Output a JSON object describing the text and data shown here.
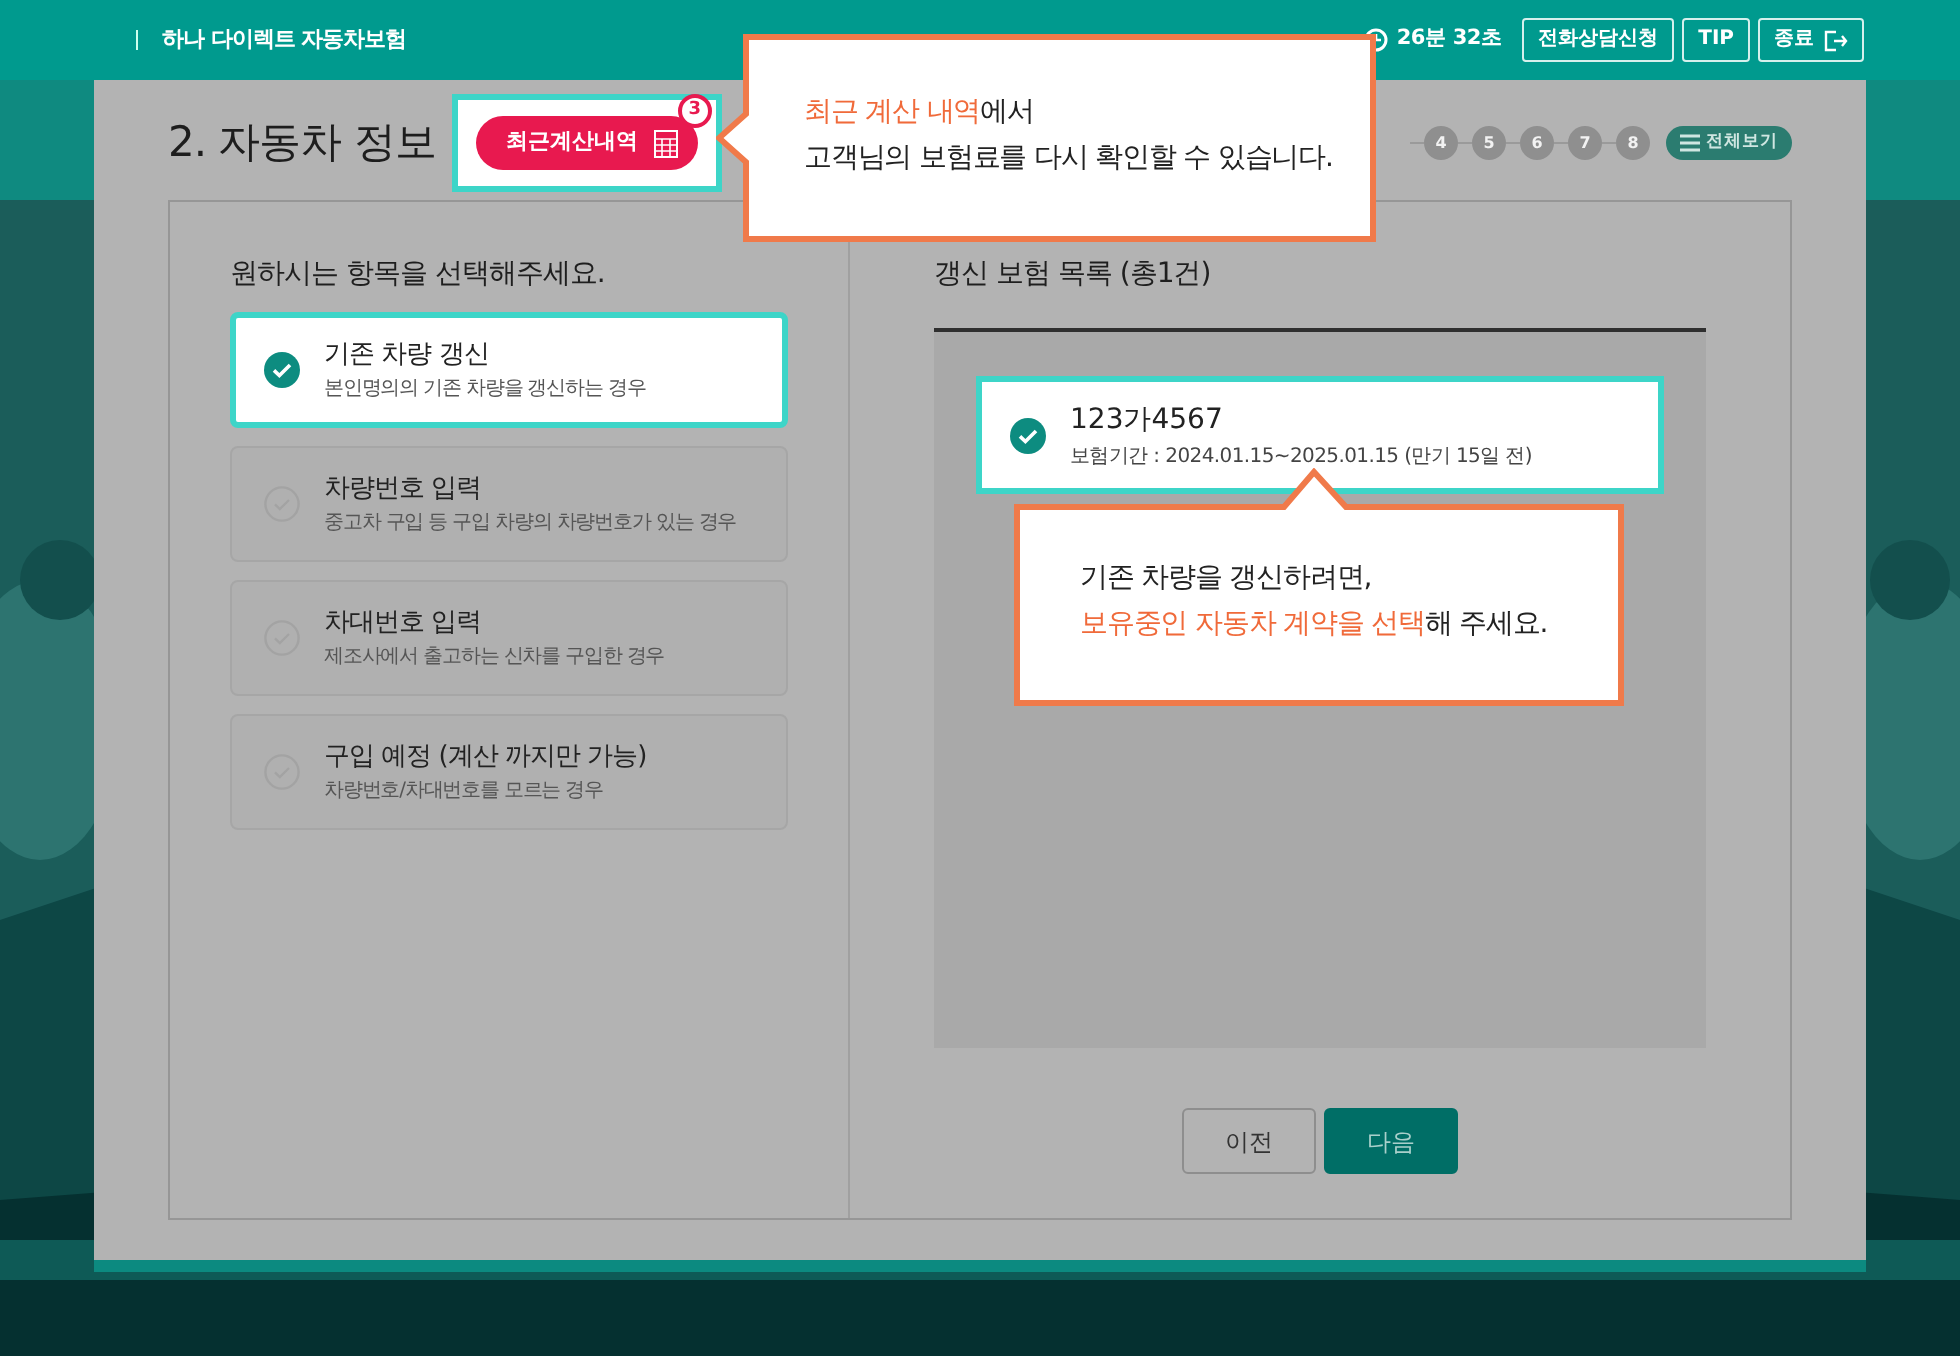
{
  "header": {
    "title": "하나 다이렉트 자동차보험",
    "timer": "26분 32초",
    "buttons": [
      {
        "label": "전화상담신청",
        "kind": "text"
      },
      {
        "label": "TIP",
        "kind": "text"
      },
      {
        "label": "종료",
        "kind": "exit"
      }
    ]
  },
  "page": {
    "title": "2. 자동차 정보",
    "recent_button": {
      "label": "최근계산내역",
      "badge": "3"
    },
    "steps": [
      {
        "label": "4"
      },
      {
        "label": "5"
      },
      {
        "label": "6"
      },
      {
        "label": "7"
      },
      {
        "label": "8"
      }
    ],
    "overview_button": "전체보기"
  },
  "options": {
    "heading": "원하시는 항목을 선택해주세요.",
    "items": [
      {
        "title": "기존 차량 갱신",
        "desc": "본인명의의 기존 차량을 갱신하는 경우",
        "selected": true
      },
      {
        "title": "차량번호 입력",
        "desc": "중고차 구입 등 구입 차량의 차량번호가 있는 경우",
        "selected": false
      },
      {
        "title": "차대번호 입력",
        "desc": "제조사에서 출고하는 신차를 구입한 경우",
        "selected": false
      },
      {
        "title": "구입 예정 (계산 까지만 가능)",
        "desc": "차량번호/차대번호를 모르는 경우",
        "selected": false
      }
    ]
  },
  "renewal": {
    "heading": "갱신 보험 목록 (총1건)",
    "items": [
      {
        "plate": "123가4567",
        "period": "보험기간 : 2024.01.15~2025.01.15 (만기 15일 전)",
        "selected": true
      }
    ]
  },
  "nav_buttons": [
    {
      "label": "이전",
      "kind": "secondary"
    },
    {
      "label": "다음",
      "kind": "primary"
    }
  ],
  "tips": [
    {
      "kind": "left",
      "lines": [
        "**최근 계산 내역**에서",
        "고객님의 보험료를 다시 확인할 수 있습니다."
      ]
    },
    {
      "kind": "up",
      "lines": [
        "기존 차량을 갱신하려면,",
        "**보유중인 자동차 계약을 선택**해 주세요."
      ]
    }
  ]
}
